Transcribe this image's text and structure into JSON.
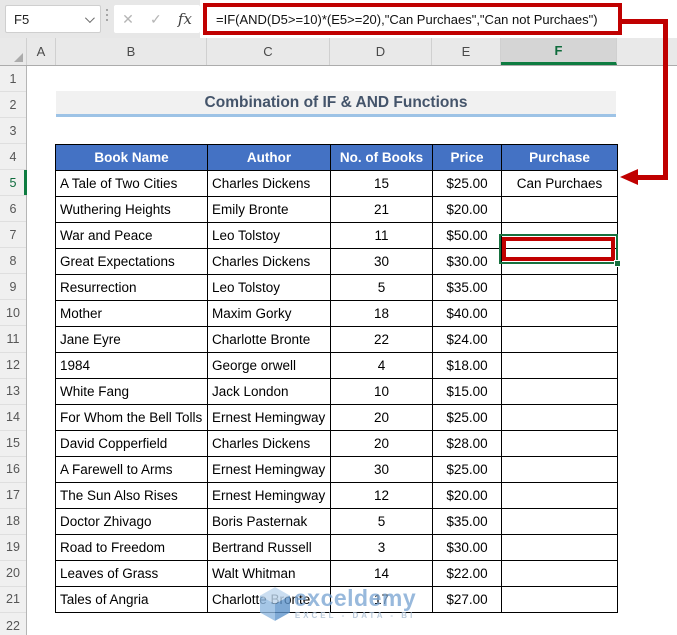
{
  "topbar": {
    "name_box_value": "F5",
    "cancel_label": "✕",
    "enter_label": "✓",
    "fx_label": "fx",
    "formula": "=IF(AND(D5>=10)*(E5>=20),\"Can Purchaes\",\"Can not Purchaes\")"
  },
  "column_headers": [
    "A",
    "B",
    "C",
    "D",
    "E",
    "F"
  ],
  "selected_column": "F",
  "row_numbers": [
    "1",
    "2",
    "3",
    "4",
    "5",
    "6",
    "7",
    "8",
    "9",
    "10",
    "11",
    "12",
    "13",
    "14",
    "15",
    "16",
    "17",
    "18",
    "19",
    "20",
    "21",
    "22"
  ],
  "selected_row": "5",
  "banner": {
    "title": "Combination of IF & AND Functions"
  },
  "table": {
    "headers": [
      "Book Name",
      "Author",
      "No. of Books",
      "Price",
      "Purchase"
    ],
    "rows": [
      [
        "A Tale of Two Cities",
        "Charles Dickens",
        "15",
        "$25.00",
        "Can Purchaes"
      ],
      [
        "Wuthering Heights",
        "Emily Bronte",
        "21",
        "$20.00",
        ""
      ],
      [
        "War and Peace",
        "Leo Tolstoy",
        "11",
        "$50.00",
        ""
      ],
      [
        "Great Expectations",
        "Charles Dickens",
        "30",
        "$30.00",
        ""
      ],
      [
        "Resurrection",
        "Leo Tolstoy",
        "5",
        "$35.00",
        ""
      ],
      [
        "Mother",
        "Maxim Gorky",
        "18",
        "$40.00",
        ""
      ],
      [
        "Jane Eyre",
        "Charlotte Bronte",
        "22",
        "$24.00",
        ""
      ],
      [
        "1984",
        "George orwell",
        "4",
        "$18.00",
        ""
      ],
      [
        "White Fang",
        "Jack London",
        "10",
        "$15.00",
        ""
      ],
      [
        "For Whom the Bell Tolls",
        "Ernest Hemingway",
        "20",
        "$25.00",
        ""
      ],
      [
        "David Copperfield",
        "Charles Dickens",
        "20",
        "$28.00",
        ""
      ],
      [
        "A Farewell to Arms",
        "Ernest Hemingway",
        "30",
        "$25.00",
        ""
      ],
      [
        "The Sun Also Rises",
        "Ernest Hemingway",
        "12",
        "$20.00",
        ""
      ],
      [
        "Doctor Zhivago",
        "Boris Pasternak",
        "5",
        "$35.00",
        ""
      ],
      [
        "Road to Freedom",
        "Bertrand Russell",
        "3",
        "$30.00",
        ""
      ],
      [
        "Leaves of Grass",
        "Walt Whitman",
        "14",
        "$22.00",
        ""
      ],
      [
        "Tales of Angria",
        "Charlotte Bronte",
        "17",
        "$27.00",
        ""
      ]
    ]
  },
  "active_cell": {
    "ref": "F5",
    "value": "Can Purchaes"
  },
  "watermark": {
    "brand": "exceldemy",
    "tagline": "EXCEL - DATA - BI"
  },
  "colors": {
    "header_blue": "#4472C4",
    "annotation_red": "#C00000",
    "selection_green": "#17713F",
    "banner_underline": "#9DC3E6",
    "title_text": "#44546A",
    "watermark_blue": "#7FA8D4"
  }
}
